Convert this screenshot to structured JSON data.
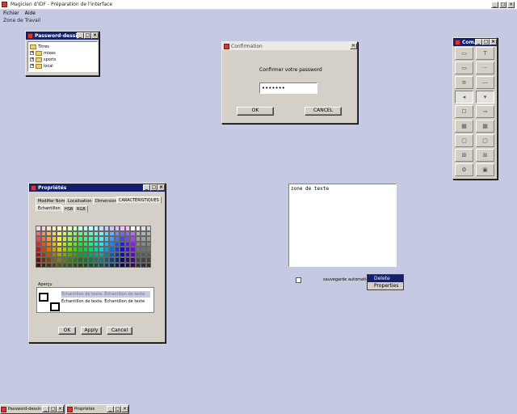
{
  "app": {
    "title": "Magicien d'IDF - Préparation de l'interface",
    "menu": [
      "Fichier",
      "Aide"
    ],
    "zone_label": "Zone de Travail"
  },
  "password_window": {
    "title": "Password-dessin...",
    "root": "Titres",
    "items": [
      "mixes",
      "sports",
      "local"
    ]
  },
  "confirm_dialog": {
    "title": "Confirmation",
    "prompt": "Confirmer votre password",
    "value": "•••••••",
    "ok": "OK",
    "cancel": "CANCEL"
  },
  "toolbox": {
    "title": "Com...",
    "tool_icons": [
      "button-icon",
      "label-icon",
      "textfield-icon",
      "dotted-line-icon",
      "list-icon",
      "separator-icon",
      "radio-left-icon",
      "radio-down-icon",
      "checkbox-icon",
      "slider-icon",
      "grid-icon",
      "grid-icon",
      "panel-icon",
      "panel-icon",
      "tree-icon",
      "tree-icon",
      "settings-icon",
      "image-icon"
    ]
  },
  "properties_window": {
    "title": "Propriétés",
    "tabs": [
      "Modifier Nom",
      "Localisation",
      "Dimension",
      "CARACTÉRISTIQUES"
    ],
    "subtabs": [
      "Échantillon",
      "HSB",
      "RGB"
    ],
    "apercu_label": "Aperçu",
    "sample_line1": "Échantillon de texte. Échantillon de texte",
    "sample_line2": "Échantillon de texte. Échantillon de texte",
    "ok": "OK",
    "apply": "Apply",
    "cancel": "Cancel",
    "palette": [
      "#ffd0e0",
      "#ffd0d0",
      "#ffe0d0",
      "#fff0c0",
      "#fffac0",
      "#f0ffc0",
      "#e0ffc0",
      "#d0ffd0",
      "#c0ffe0",
      "#c0fff0",
      "#c0ffff",
      "#c0f0ff",
      "#c0e0ff",
      "#c0d0ff",
      "#d0c0ff",
      "#e0c0ff",
      "#f0c0ff",
      "#ffc0ff",
      "#ffffff",
      "#f0f0f0",
      "#e0e0e0",
      "#d0d0d0"
    ]
  },
  "text_area": {
    "value": "zone de texte"
  },
  "checkbox_label": "sauvegarde automatiq",
  "context_menu": [
    "Delete",
    "Properties"
  ],
  "taskbar": [
    {
      "title": "Password-dessin"
    },
    {
      "title": "Propriétés"
    }
  ]
}
